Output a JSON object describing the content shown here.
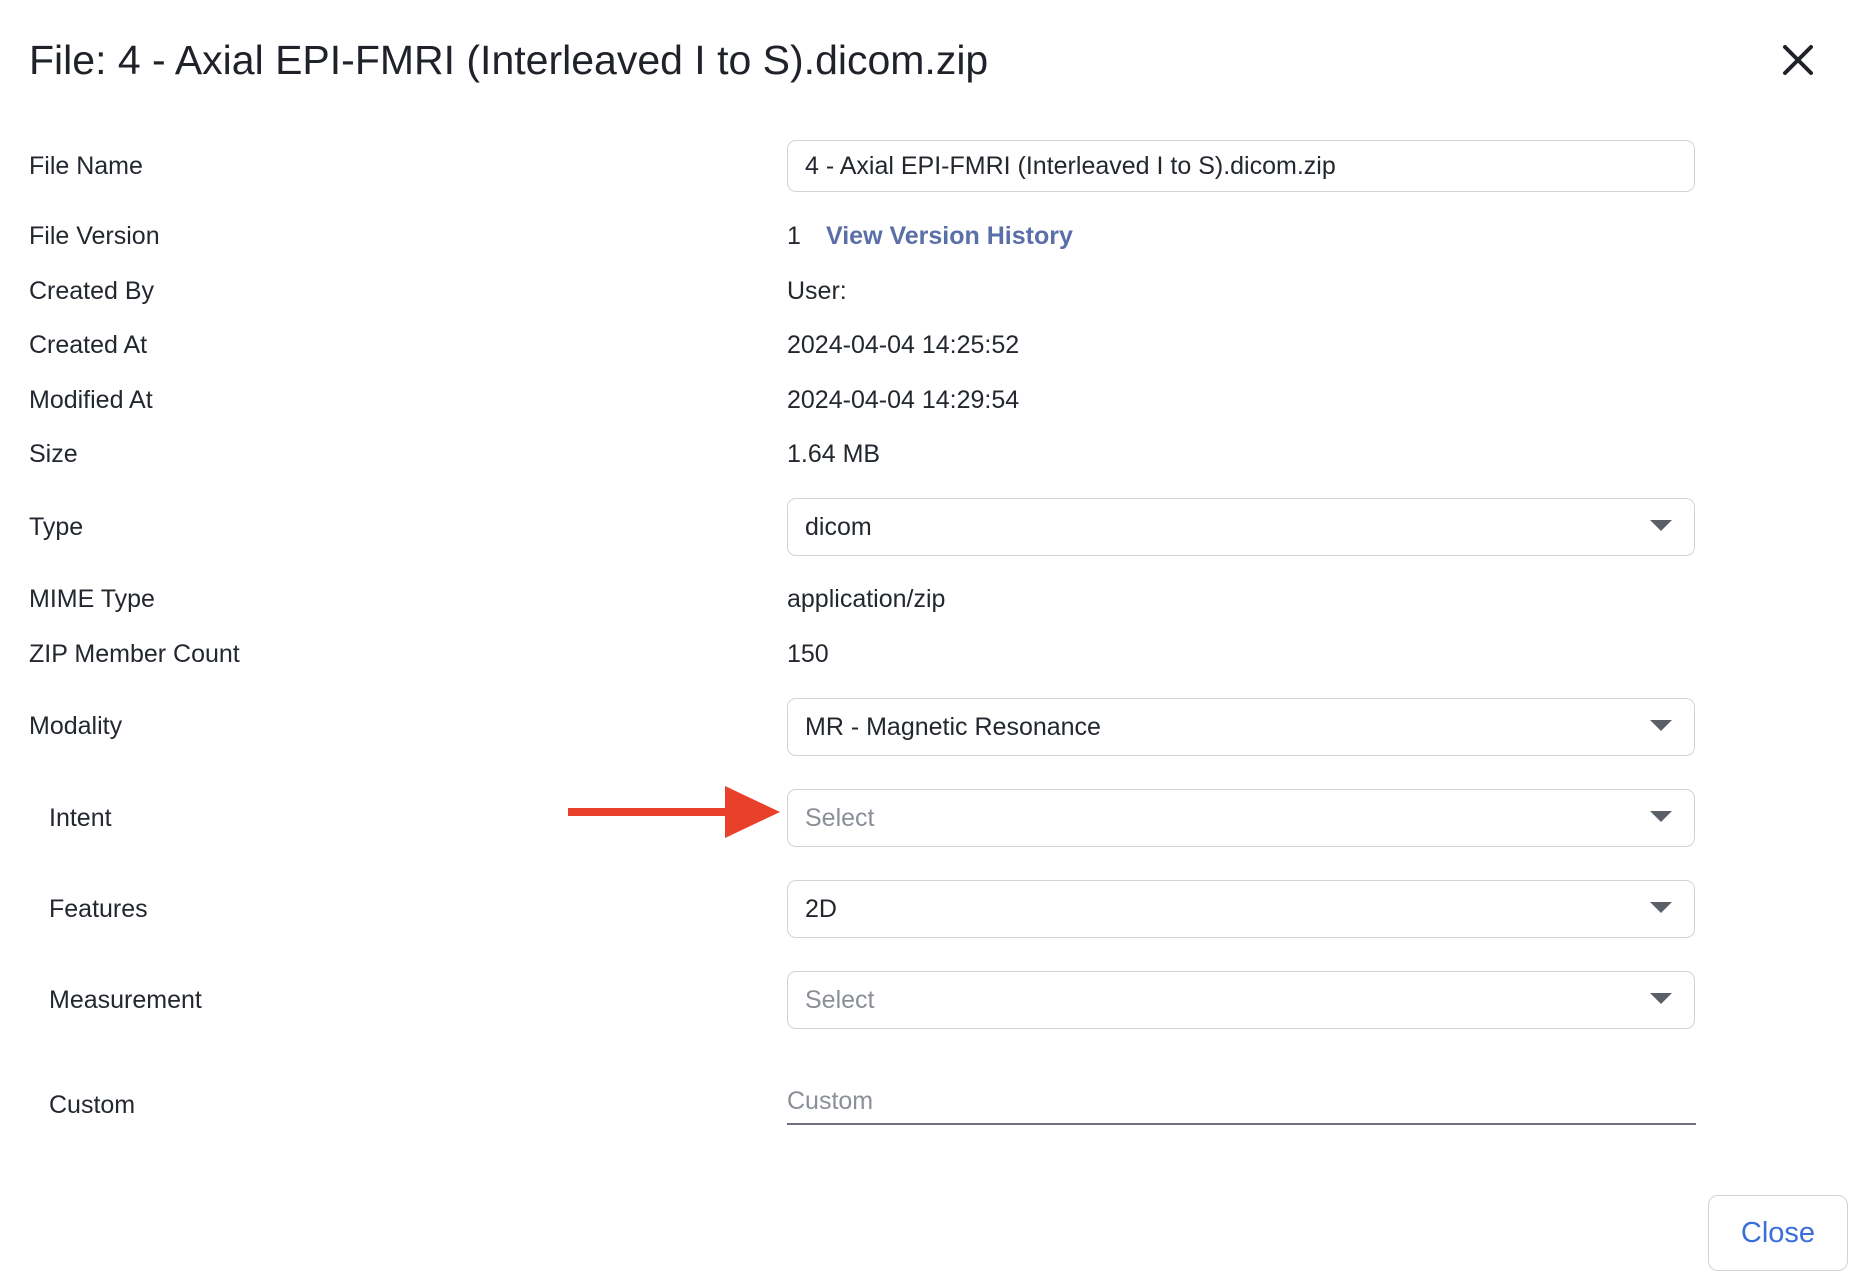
{
  "dialog": {
    "title": "File: 4 - Axial EPI-FMRI (Interleaved I to S).dicom.zip",
    "close_button_label": "Close"
  },
  "labels": {
    "file_name": "File Name",
    "file_version": "File Version",
    "created_by": "Created By",
    "created_at": "Created At",
    "modified_at": "Modified At",
    "size": "Size",
    "type": "Type",
    "mime_type": "MIME Type",
    "zip_member_count": "ZIP Member Count",
    "modality": "Modality",
    "intent": "Intent",
    "features": "Features",
    "measurement": "Measurement",
    "custom": "Custom"
  },
  "values": {
    "file_name": "4 - Axial EPI-FMRI (Interleaved I to S).dicom.zip",
    "file_version": "1",
    "view_version_history": "View Version History",
    "created_by": "User: ",
    "created_at": "2024-04-04 14:25:52",
    "modified_at": "2024-04-04 14:29:54",
    "size": "1.64 MB",
    "type": "dicom",
    "mime_type": "application/zip",
    "zip_member_count": "150",
    "modality": "MR - Magnetic Resonance",
    "intent_placeholder": "Select",
    "features": "2D",
    "measurement_placeholder": "Select",
    "custom_placeholder": "Custom"
  },
  "colors": {
    "link": "#5a6ea8",
    "close_button_text": "#3a6fd8",
    "annotation_arrow": "#e8402a"
  },
  "icons": {
    "close": "close-icon",
    "dropdown": "chevron-down-icon",
    "annotation": "arrow-right-icon"
  }
}
